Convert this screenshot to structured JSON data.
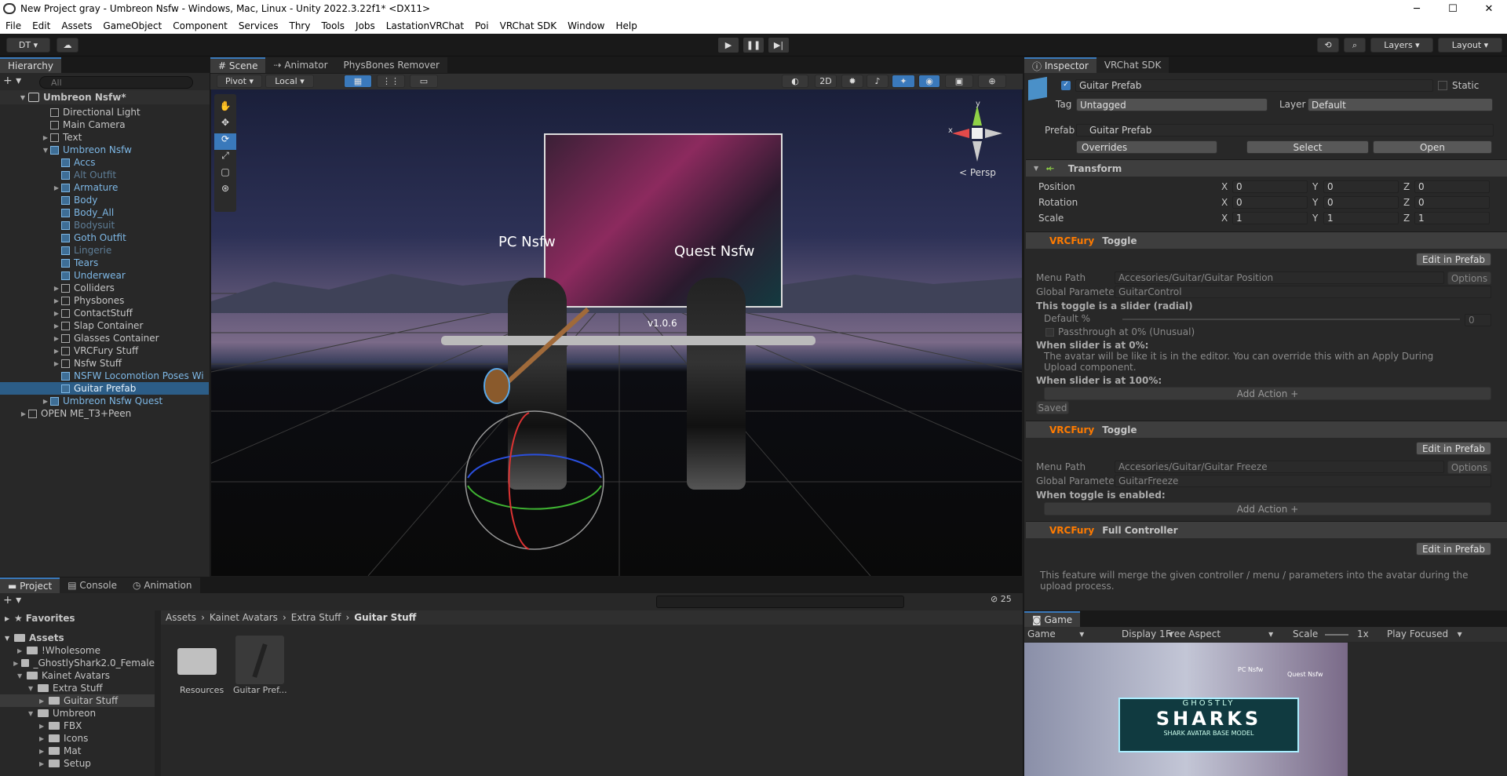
{
  "window": {
    "title": "New Project gray - Umbreon Nsfw - Windows, Mac, Linux - Unity 2022.3.22f1* <DX11>",
    "minimize": "─",
    "maximize": "☐",
    "close": "✕"
  },
  "menu": [
    "File",
    "Edit",
    "Assets",
    "GameObject",
    "Component",
    "Services",
    "Thry",
    "Tools",
    "Jobs",
    "LastationVRChat",
    "Poi",
    "VRChat SDK",
    "Window",
    "Help"
  ],
  "toolbar": {
    "account": "DT ▾",
    "cloud": "☁",
    "layers": "Layers",
    "layout": "Layout"
  },
  "hierarchy": {
    "tab": "Hierarchy",
    "search_placeholder": "All",
    "scene": "Umbreon Nsfw*",
    "items": [
      {
        "label": "Directional Light",
        "depth": 1,
        "type": "obj"
      },
      {
        "label": "Main Camera",
        "depth": 1,
        "type": "obj"
      },
      {
        "label": "Text",
        "depth": 1,
        "type": "obj",
        "arrow": true
      },
      {
        "label": "Umbreon Nsfw",
        "depth": 1,
        "type": "prefab",
        "open": true
      },
      {
        "label": "Accs",
        "depth": 2,
        "type": "prefab"
      },
      {
        "label": "Alt Outfit",
        "depth": 2,
        "type": "prefab",
        "dim": true
      },
      {
        "label": "Armature",
        "depth": 2,
        "type": "prefab",
        "arrow": true
      },
      {
        "label": "Body",
        "depth": 2,
        "type": "prefab"
      },
      {
        "label": "Body_All",
        "depth": 2,
        "type": "prefab"
      },
      {
        "label": "Bodysuit",
        "depth": 2,
        "type": "prefab",
        "dim": true
      },
      {
        "label": "Goth Outfit",
        "depth": 2,
        "type": "prefab"
      },
      {
        "label": "Lingerie",
        "depth": 2,
        "type": "prefab",
        "dim": true
      },
      {
        "label": "Tears",
        "depth": 2,
        "type": "prefab"
      },
      {
        "label": "Underwear",
        "depth": 2,
        "type": "prefab"
      },
      {
        "label": "Colliders",
        "depth": 2,
        "type": "obj",
        "arrow": true
      },
      {
        "label": "Physbones",
        "depth": 2,
        "type": "obj",
        "arrow": true
      },
      {
        "label": "ContactStuff",
        "depth": 2,
        "type": "obj",
        "arrow": true
      },
      {
        "label": "Slap Container",
        "depth": 2,
        "type": "obj",
        "arrow": true
      },
      {
        "label": "Glasses Container",
        "depth": 2,
        "type": "obj",
        "arrow": true
      },
      {
        "label": "VRCFury Stuff",
        "depth": 2,
        "type": "obj",
        "arrow": true
      },
      {
        "label": "Nsfw Stuff",
        "depth": 2,
        "type": "obj",
        "arrow": true
      },
      {
        "label": "NSFW Locomotion Poses Wi",
        "depth": 2,
        "type": "prefab"
      },
      {
        "label": "Guitar Prefab",
        "depth": 2,
        "type": "prefab",
        "selected": true
      },
      {
        "label": "Umbreon Nsfw Quest",
        "depth": 1,
        "type": "prefab",
        "arrow": true
      },
      {
        "label": "OPEN ME_T3+Peen",
        "depth": 0,
        "type": "scene",
        "arrow": true
      }
    ]
  },
  "scene_view": {
    "tabs": [
      "Scene",
      "Animator",
      "PhysBones Remover"
    ],
    "pivot": "Pivot",
    "local": "Local",
    "mode_2d": "2D",
    "persp": "< Persp",
    "label_pc": "PC Nsfw",
    "label_quest": "Quest Nsfw",
    "version": "v1.0.6",
    "gizmo_x": "x",
    "gizmo_y": "y"
  },
  "inspector": {
    "tabs": [
      "Inspector",
      "VRChat SDK"
    ],
    "object_name": "Guitar Prefab",
    "static_label": "Static",
    "tag_label": "Tag",
    "tag_value": "Untagged",
    "layer_label": "Layer",
    "layer_value": "Default",
    "prefab_label": "Prefab",
    "prefab_value": "Guitar Prefab",
    "overrides": "Overrides",
    "select": "Select",
    "open": "Open",
    "transform": {
      "title": "Transform",
      "rows": [
        {
          "label": "Position",
          "x": "0",
          "y": "0",
          "z": "0"
        },
        {
          "label": "Rotation",
          "x": "0",
          "y": "0",
          "z": "0"
        },
        {
          "label": "Scale",
          "x": "1",
          "y": "1",
          "z": "1"
        }
      ]
    },
    "comp1": {
      "brand": "VRCFury",
      "title": "Toggle",
      "edit": "Edit in Prefab",
      "menu_path_label": "Menu Path",
      "menu_path": "Accesories/Guitar/Guitar Position",
      "options": "Options",
      "global_param_label": "Global Parameter",
      "global_param": "GuitarControl",
      "slider_note": "This toggle is a slider (radial)",
      "default_label": "Default %",
      "default_value": "0",
      "passthrough": "Passthrough at 0% (Unusual)",
      "at0_title": "When slider is at 0%:",
      "at0_text": "The avatar will be like it is in the editor. You can override this with an Apply During Upload component.",
      "at100_title": "When slider is at 100%:",
      "add_action": "Add Action +",
      "saved": "Saved"
    },
    "comp2": {
      "brand": "VRCFury",
      "title": "Toggle",
      "edit": "Edit in Prefab",
      "menu_path_label": "Menu Path",
      "menu_path": "Accesories/Guitar/Guitar Freeze",
      "options": "Options",
      "global_param_label": "Global Parameter",
      "global_param": "GuitarFreeze",
      "enabled_title": "When toggle is enabled:",
      "add_action": "Add Action +"
    },
    "comp3": {
      "brand": "VRCFury",
      "title": "Full Controller",
      "edit": "Edit in Prefab",
      "text": "This feature will merge the given controller / menu / parameters into the avatar during the upload process."
    }
  },
  "project": {
    "tabs": [
      "Project",
      "Console",
      "Animation"
    ],
    "favorites": "Favorites",
    "assets": "Assets",
    "tree": [
      {
        "label": "!Wholesome",
        "depth": 1
      },
      {
        "label": "_GhostlyShark2.0_Female",
        "depth": 1
      },
      {
        "label": "Kainet Avatars",
        "depth": 1,
        "open": true
      },
      {
        "label": "Extra Stuff",
        "depth": 2,
        "open": true
      },
      {
        "label": "Guitar Stuff",
        "depth": 3,
        "selected": true
      },
      {
        "label": "Umbreon",
        "depth": 2,
        "open": true
      },
      {
        "label": "FBX",
        "depth": 3
      },
      {
        "label": "Icons",
        "depth": 3
      },
      {
        "label": "Mat",
        "depth": 3
      },
      {
        "label": "Setup",
        "depth": 3
      }
    ],
    "breadcrumb": [
      "Assets",
      "Kainet Avatars",
      "Extra Stuff",
      "Guitar Stuff"
    ],
    "files": [
      {
        "label": "Resources",
        "kind": "folder"
      },
      {
        "label": "Guitar Pref...",
        "kind": "prefab"
      }
    ],
    "hidden_count": "25"
  },
  "game": {
    "tab": "Game",
    "display_mode": "Game",
    "display": "Display 1",
    "aspect": "Free Aspect",
    "scale_label": "Scale",
    "scale_value": "1x",
    "play_mode": "Play Focused",
    "sharks_top": "GHOSTLY",
    "sharks": "SHARKS",
    "sharks_sub": "SHARK AVATAR BASE MODEL",
    "label_pc": "PC Nsfw",
    "label_quest": "Quest Nsfw"
  },
  "colors": {
    "accent": "#3a79bb",
    "selection": "#2c5d87",
    "vrcfury": "#ff7b00",
    "prefab_text": "#7db7e5"
  }
}
